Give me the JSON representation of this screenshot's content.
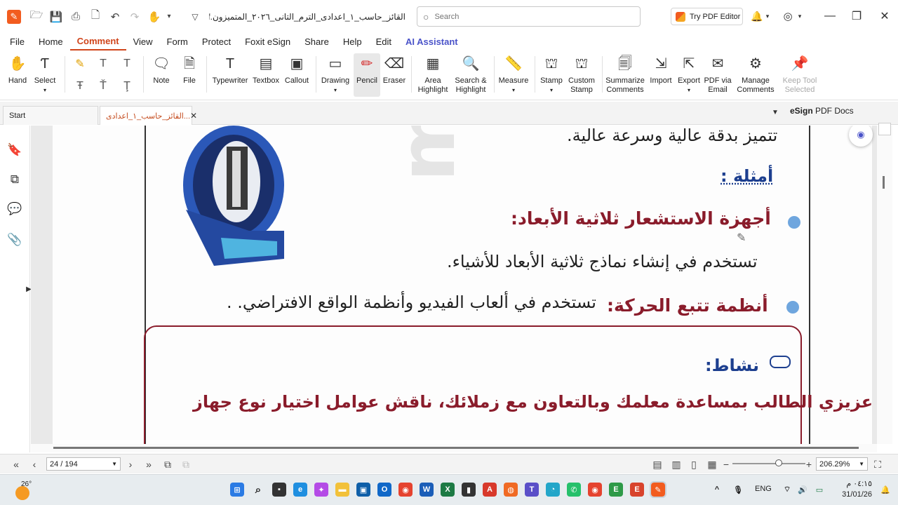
{
  "titlebar": {
    "doc_title": "القائز_حاسب_١_اعدادى_الترم_التانى_٢٠٢٦_المتميزون.pdf *",
    "search_placeholder": "Search",
    "try_editor": "Try PDF Editor"
  },
  "menu": [
    "File",
    "Home",
    "Comment",
    "View",
    "Form",
    "Protect",
    "Foxit eSign",
    "Share",
    "Help",
    "Edit",
    "AI Assistant"
  ],
  "menu_active": "Comment",
  "ribbon": {
    "hand": "Hand",
    "select": "Select",
    "note": "Note",
    "file": "File",
    "typewriter": "Typewriter",
    "textbox": "Textbox",
    "callout": "Callout",
    "drawing": "Drawing",
    "pencil": "Pencil",
    "eraser": "Eraser",
    "area_highlight_1": "Area",
    "area_highlight_2": "Highlight",
    "search_highlight_1": "Search &",
    "search_highlight_2": "Highlight",
    "measure": "Measure",
    "stamp": "Stamp",
    "custom_stamp_1": "Custom",
    "custom_stamp_2": "Stamp",
    "summarize_1": "Summarize",
    "summarize_2": "Comments",
    "import": "Import",
    "export": "Export",
    "pdf_email_1": "PDF via",
    "pdf_email_2": "Email",
    "manage_1": "Manage",
    "manage_2": "Comments",
    "keep_tool_1": "Keep Tool",
    "keep_tool_2": "Selected"
  },
  "tabs": {
    "start": "Start",
    "doc": "...القائز_حاسب_١_اعدادى",
    "esign_bold": "eSign",
    "esign_rest": " PDF Docs"
  },
  "page_text": {
    "line1": "تتميز بدقة عالية وسرعة عالية.",
    "examples_heading": "أمثلة :",
    "item1_title": "أجهزة الاستشعار ثلاثية الأبعاد:",
    "item1_body": "تستخدم في إنشاء نماذج ثلاثية الأبعاد للأشياء.",
    "item2_title": "أنظمة تتبع الحركة:",
    "item2_body": "تستخدم في ألعاب الفيديو وأنظمة الواقع الافتراضي. .",
    "activity_heading": "نشاط:",
    "activity_body": "عزيزي الطالب بمساعدة معلمك وبالتعاون مع زملائك، ناقش عوامل اختيار نوع جهاز",
    "watermark": "menG5"
  },
  "statusbar": {
    "page": "24 / 194",
    "zoom": "206.29%"
  },
  "taskbar": {
    "temperature": "26°",
    "language": "ENG",
    "time": "٠٤:١٥ م",
    "date": "31/01/26"
  },
  "colors": {
    "accent": "#d0451b",
    "ai": "#4a53c9",
    "heading_red": "#8a1c2b",
    "heading_blue": "#1d3f8f",
    "bullet": "#6fa6de"
  }
}
